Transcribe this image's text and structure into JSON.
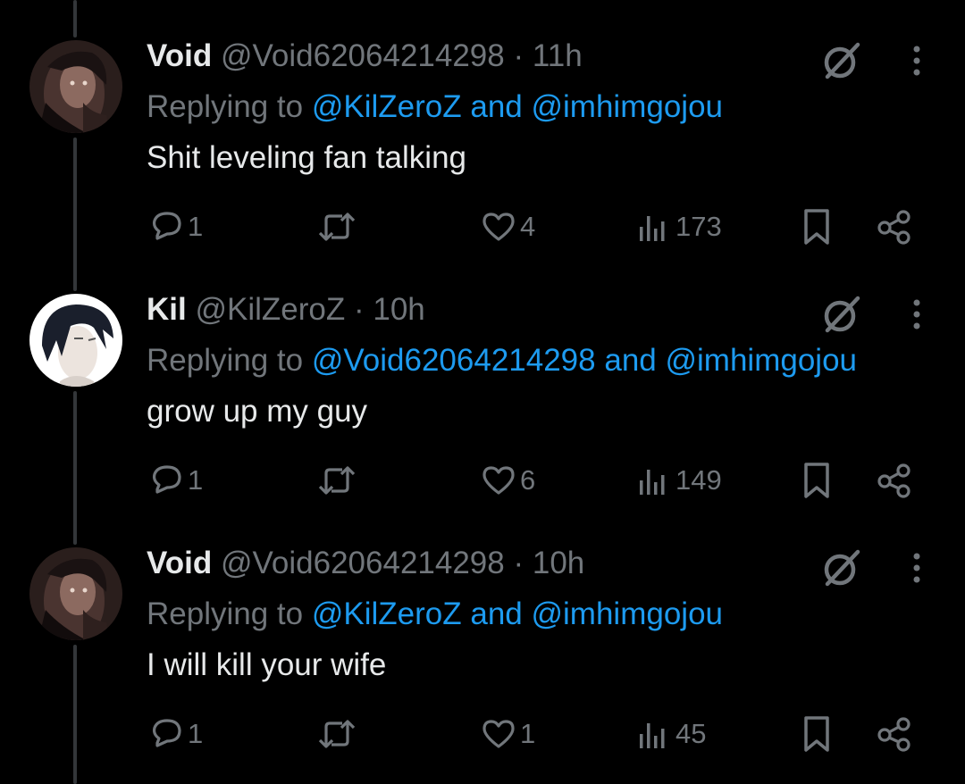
{
  "colors": {
    "background": "#000000",
    "text": "#e7e9ea",
    "muted": "#71767b",
    "link": "#1d9bf0",
    "thread_line": "#333639"
  },
  "tweets": [
    {
      "display_name": "Void",
      "handle": "@Void62064214298",
      "separator": "·",
      "time": "11h",
      "replying_prefix": "Replying to",
      "mention_1": "@KilZeroZ",
      "and_word": "and",
      "mention_2": "@imhimgojou",
      "text": "Shit leveling fan talking",
      "reply_count": "1",
      "like_count": "4",
      "view_count": "173",
      "icons": [
        "avatar",
        "grok-icon",
        "more-icon",
        "reply-icon",
        "retweet-icon",
        "like-icon",
        "views-icon",
        "bookmark-icon",
        "share-icon"
      ]
    },
    {
      "display_name": "Kil",
      "handle": "@KilZeroZ",
      "separator": "·",
      "time": "10h",
      "replying_prefix": "Replying to",
      "mention_1": "@Void62064214298",
      "and_word": "and",
      "mention_2": "@imhimgojou",
      "text": "grow up my guy",
      "reply_count": "1",
      "like_count": "6",
      "view_count": "149",
      "icons": [
        "avatar",
        "grok-icon",
        "more-icon",
        "reply-icon",
        "retweet-icon",
        "like-icon",
        "views-icon",
        "bookmark-icon",
        "share-icon"
      ]
    },
    {
      "display_name": "Void",
      "handle": "@Void62064214298",
      "separator": "·",
      "time": "10h",
      "replying_prefix": "Replying to",
      "mention_1": "@KilZeroZ",
      "and_word": "and",
      "mention_2": "@imhimgojou",
      "text": "I will kill your wife",
      "reply_count": "1",
      "like_count": "1",
      "view_count": "45",
      "icons": [
        "avatar",
        "grok-icon",
        "more-icon",
        "reply-icon",
        "retweet-icon",
        "like-icon",
        "views-icon",
        "bookmark-icon",
        "share-icon"
      ]
    }
  ]
}
